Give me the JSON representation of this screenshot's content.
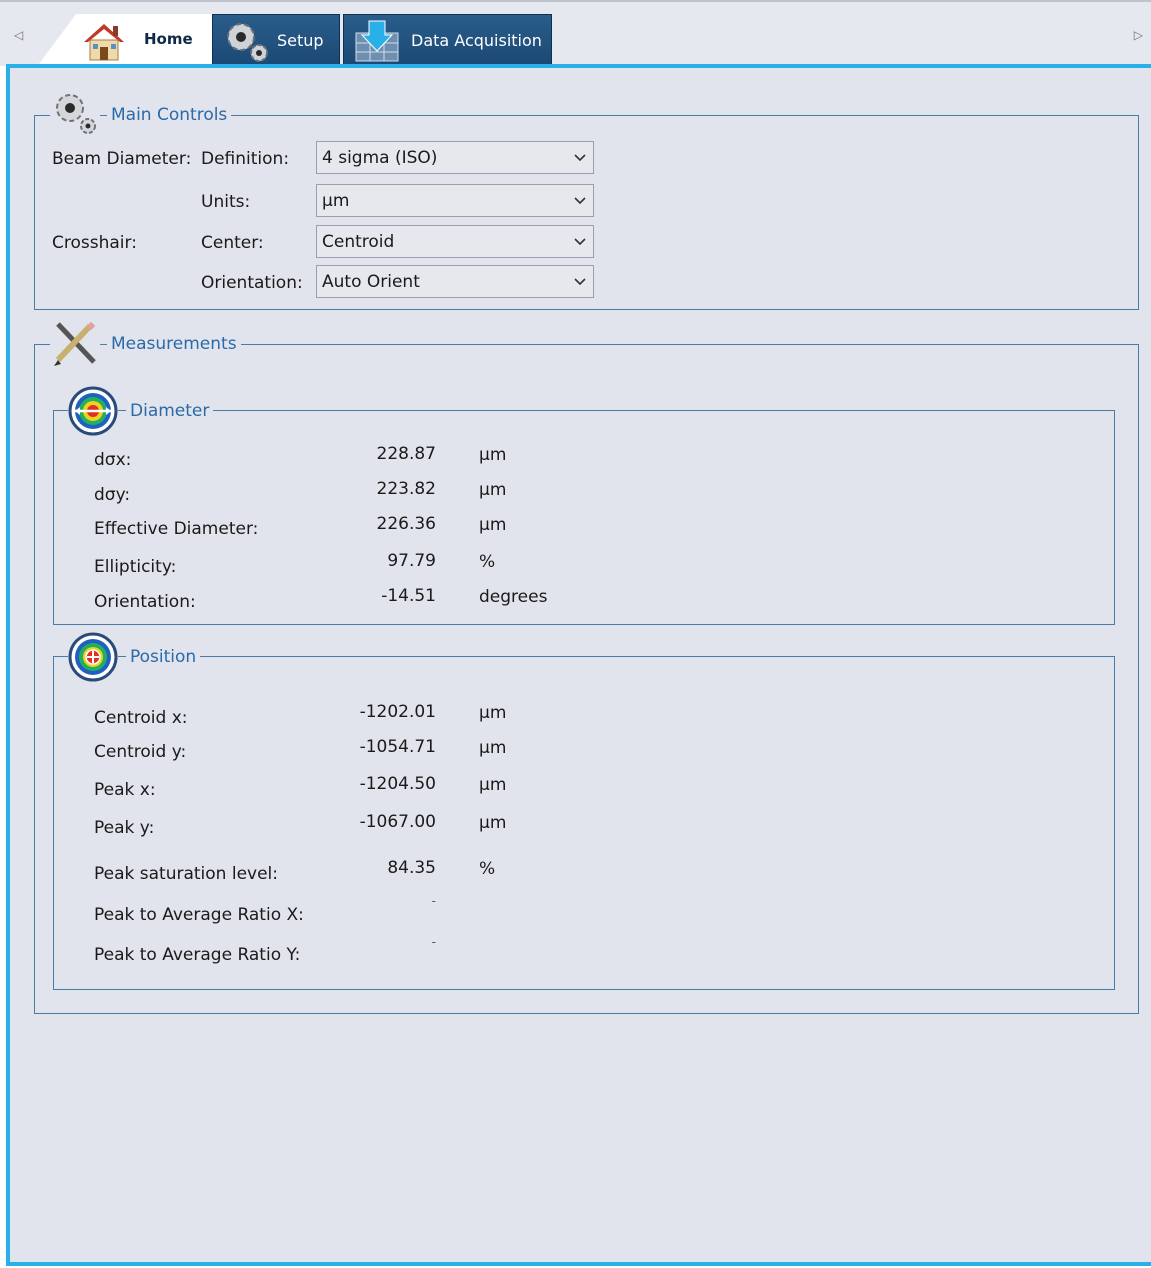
{
  "tabs": [
    {
      "label": "Home",
      "icon": "house-icon"
    },
    {
      "label": "Setup",
      "icon": "gears-icon"
    },
    {
      "label": "Data Acquisition",
      "icon": "download-icon"
    }
  ],
  "main_controls": {
    "title": "Main Controls",
    "beam_diameter_label": "Beam Diameter:",
    "definition_label": "Definition:",
    "definition_value": "4 sigma (ISO)",
    "units_label": "Units:",
    "units_value": "µm",
    "crosshair_label": "Crosshair:",
    "center_label": "Center:",
    "center_value": "Centroid",
    "orientation_label": "Orientation:",
    "orientation_value": "Auto Orient"
  },
  "measurements": {
    "title": "Measurements",
    "diameter": {
      "title": "Diameter",
      "rows": [
        {
          "label": "dσx:",
          "value": "228.87",
          "unit": "µm"
        },
        {
          "label": "dσy:",
          "value": "223.82",
          "unit": "µm"
        },
        {
          "label": "Effective Diameter:",
          "value": "226.36",
          "unit": "µm"
        },
        {
          "label": "Ellipticity:",
          "value": "97.79",
          "unit": "%"
        },
        {
          "label": "Orientation:",
          "value": "-14.51",
          "unit": "degrees"
        }
      ]
    },
    "position": {
      "title": "Position",
      "rows": [
        {
          "label": "Centroid x:",
          "value": "-1202.01",
          "unit": "µm"
        },
        {
          "label": "Centroid y:",
          "value": "-1054.71",
          "unit": "µm"
        },
        {
          "label": "Peak x:",
          "value": "-1204.50",
          "unit": "µm"
        },
        {
          "label": "Peak y:",
          "value": "-1067.00",
          "unit": "µm"
        },
        {
          "label": "Peak saturation level:",
          "value": "84.35",
          "unit": "%"
        },
        {
          "label": "Peak to Average Ratio X:",
          "value": "-",
          "unit": ""
        },
        {
          "label": "Peak to Average Ratio Y:",
          "value": "-",
          "unit": ""
        }
      ]
    }
  }
}
